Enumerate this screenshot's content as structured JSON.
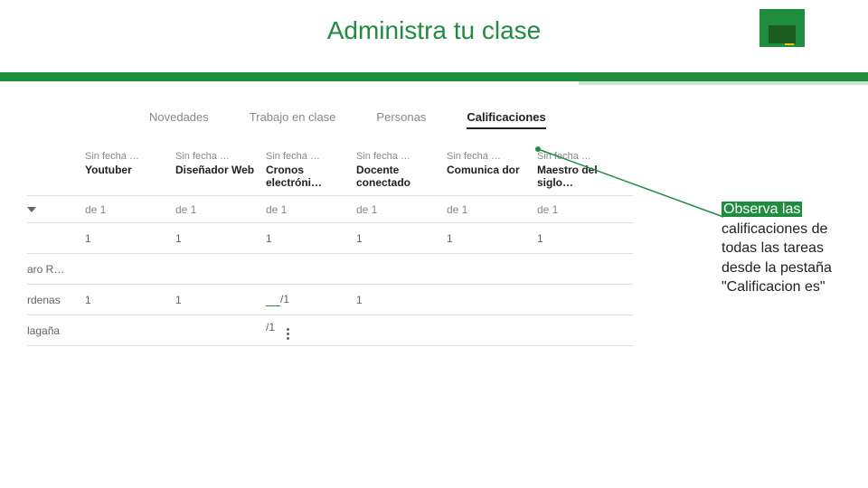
{
  "header": {
    "title": "Administra tu clase"
  },
  "tabs": {
    "items": [
      "Novedades",
      "Trabajo en clase",
      "Personas",
      "Calificaciones"
    ],
    "active": 3
  },
  "columns": [
    {
      "date": "Sin fecha …",
      "title": "Youtuber",
      "outof": "de 1"
    },
    {
      "date": "Sin fecha …",
      "title": "Diseñador Web",
      "outof": "de 1"
    },
    {
      "date": "Sin fecha …",
      "title": "Cronos electróni…",
      "outof": "de 1"
    },
    {
      "date": "Sin fecha …",
      "title": "Docente conectado",
      "outof": "de 1"
    },
    {
      "date": "Sin fecha …",
      "title": "Comunica dor",
      "outof": "de 1"
    },
    {
      "date": "Sin fecha …",
      "title": "Maestro del siglo…",
      "outof": "de 1"
    }
  ],
  "rows": [
    {
      "name": "",
      "grades": [
        "1",
        "1",
        "1",
        "1",
        "1",
        "1"
      ]
    },
    {
      "name": "aro R…",
      "grades": [
        "",
        "",
        "",
        "",
        "",
        ""
      ]
    },
    {
      "name": "rdenas",
      "grades": [
        "1",
        "1",
        "__/1",
        "1",
        "",
        ""
      ]
    },
    {
      "name": "lagaña",
      "grades": [
        "",
        "",
        "/1",
        "",
        "",
        ""
      ],
      "hasMenu": true
    }
  ],
  "callout": {
    "line1": "Observa las",
    "rest": "calificaciones de todas las tareas desde la pestaña \"Calificacion es\""
  }
}
